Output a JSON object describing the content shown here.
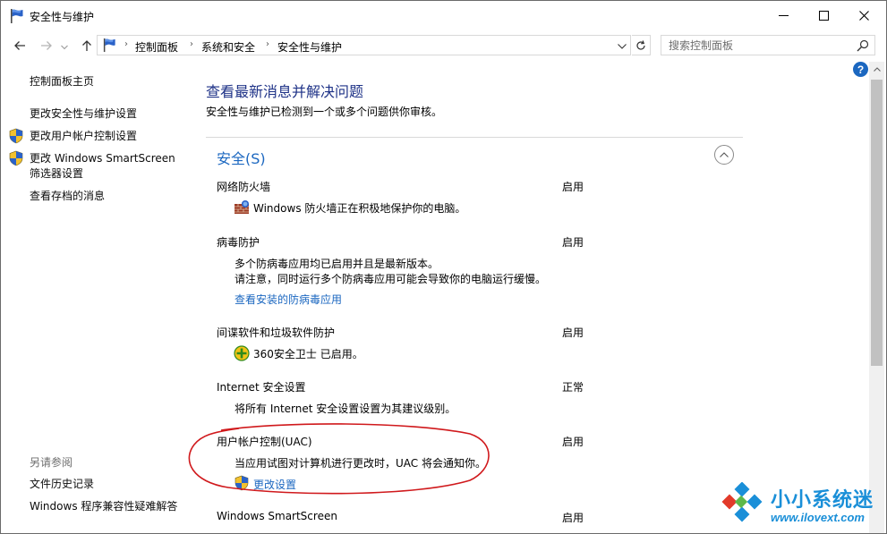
{
  "window": {
    "title": "安全性与维护"
  },
  "nav": {
    "breadcrumbs": [
      "控制面板",
      "系统和安全",
      "安全性与维护"
    ],
    "search_placeholder": "搜索控制面板"
  },
  "sidebar": {
    "home": "控制面板主页",
    "links": [
      "更改安全性与维护设置",
      "更改用户帐户控制设置",
      "更改 Windows SmartScreen",
      "筛选器设置",
      "查看存档的消息"
    ],
    "see_also_heading": "另请参阅",
    "see_also": [
      "文件历史记录",
      "Windows 程序兼容性疑难解答"
    ]
  },
  "main": {
    "title": "查看最新消息并解决问题",
    "subtitle": "安全性与维护已检测到一个或多个问题供你审核。",
    "section": {
      "heading": "安全(S)",
      "items": [
        {
          "title": "网络防火墙",
          "status": "启用",
          "desc": [
            "Windows 防火墙正在积极地保护你的电脑。"
          ],
          "icon": "firewall-icon"
        },
        {
          "title": "病毒防护",
          "status": "启用",
          "desc": [
            "多个防病毒应用均已启用并且是最新版本。",
            "请注意，同时运行多个防病毒应用可能会导致你的电脑运行缓慢。"
          ],
          "link": "查看安装的防病毒应用"
        },
        {
          "title": "间谍软件和垃圾软件防护",
          "status": "启用",
          "desc": [
            "360安全卫士 已启用。"
          ],
          "icon": "360-safeguard-icon"
        },
        {
          "title": "Internet 安全设置",
          "status": "正常",
          "desc": [
            "将所有 Internet 安全设置设置为其建议级别。"
          ]
        },
        {
          "title": "用户帐户控制(UAC)",
          "status": "启用",
          "desc": [
            "当应用试图对计算机进行更改时，UAC 将会通知你。"
          ],
          "link": "更改设置",
          "link_icon": "uac-shield-icon"
        },
        {
          "title": "Windows SmartScreen",
          "status": "启用"
        }
      ]
    }
  },
  "watermark": {
    "text": "小小系统迷",
    "url": "www.ilovext.com"
  },
  "colors": {
    "link_blue": "#1b67c0",
    "title_blue": "#1e3287",
    "annotation_red": "#d0191c"
  }
}
